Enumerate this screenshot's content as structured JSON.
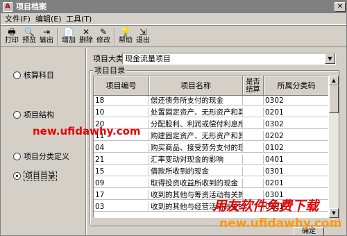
{
  "window": {
    "title": "项目档案",
    "close_glyph": "✕",
    "app_icon_glyph": "A"
  },
  "menu": [
    "文件(F)",
    "编辑(E)",
    "工具(T)"
  ],
  "toolbar": [
    {
      "label": "打印",
      "icon": "printer-icon",
      "glyph": "🖶"
    },
    {
      "label": "预览",
      "icon": "preview-icon",
      "glyph": "🔍"
    },
    {
      "label": "输出",
      "icon": "export-icon",
      "glyph": "⇥"
    },
    {
      "label": "增加",
      "icon": "add-icon",
      "glyph": "📄"
    },
    {
      "label": "删除",
      "icon": "delete-icon",
      "glyph": "✕"
    },
    {
      "label": "修改",
      "icon": "edit-icon",
      "glyph": "✎"
    },
    {
      "label": "帮助",
      "icon": "help-icon",
      "glyph": "💡"
    },
    {
      "label": "退出",
      "icon": "exit-icon",
      "glyph": "⇲"
    }
  ],
  "sidebar": {
    "options": [
      {
        "label": "核算科目",
        "checked": false
      },
      {
        "label": "项目结构",
        "checked": false
      },
      {
        "label": "项目分类定义",
        "checked": false
      },
      {
        "label": "项目目录",
        "checked": true
      }
    ]
  },
  "category": {
    "label": "项目大类",
    "value": "现金流量项目",
    "arrow_glyph": "▼"
  },
  "catalog": {
    "group_label": "项目目录",
    "columns": [
      "项目编号",
      "项目名称",
      "是否结算",
      "所属分类码"
    ],
    "rows": [
      [
        "18",
        "偿还债务所支付的现金",
        "",
        "0302"
      ],
      [
        "10",
        "处置固定资产、无形资产和其他长期资产所收回的现金净额",
        "",
        "0201"
      ],
      [
        "20",
        "分配股利、利润或偿付利息所支付的现金",
        "",
        "0302"
      ],
      [
        "11",
        "购建固定资产、无形资产和其他长期资产所支付的现金",
        "",
        "0202"
      ],
      [
        "04",
        "购买商品、接受劳务支付的现金",
        "",
        "0102"
      ],
      [
        "21",
        "汇率变动对现金的影响",
        "",
        "0401"
      ],
      [
        "15",
        "借款所收到的现金",
        "",
        "0301"
      ],
      [
        "09",
        "取得投资收益所收到的现金",
        "",
        "0201"
      ],
      [
        "17",
        "收到的其他与筹资活动有关的现金",
        "",
        "0301"
      ],
      [
        "03",
        "收到的其他与经营活动有关的现金",
        "",
        "0101"
      ]
    ],
    "scroll_up": "▲",
    "scroll_down": "▼"
  },
  "ok_button": "确定",
  "watermarks": {
    "url_red": "new.ufidawhy.com",
    "brand": "用友软件免费下载",
    "url_orange": "new.ufidawhy.com"
  },
  "colors": {
    "titlebar": "#808080",
    "watermark_red": "#e60000",
    "watermark_orange": "#ff9900",
    "face": "#d4d0c8"
  }
}
